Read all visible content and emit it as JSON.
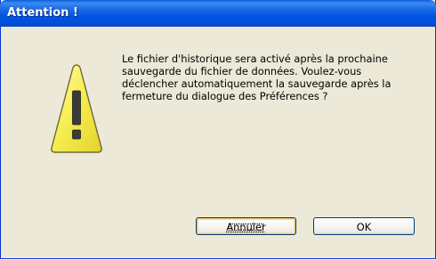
{
  "dialog": {
    "title": "Attention !",
    "icon": "warning-icon",
    "message_lines": [
      "Le fichier d'historique sera activé après la prochaine",
      "sauvegarde du fichier de données. Voulez-vous",
      "déclencher automatiquement la sauvegarde après la",
      "fermeture du dialogue des Préférences ?"
    ],
    "buttons": {
      "cancel": "Annuler",
      "ok": "OK"
    }
  },
  "colors": {
    "titlebar": "#0054e3",
    "dialog_bg": "#ece9d8",
    "warning_fill": "#f7ef55",
    "button_border": "#003c74"
  }
}
